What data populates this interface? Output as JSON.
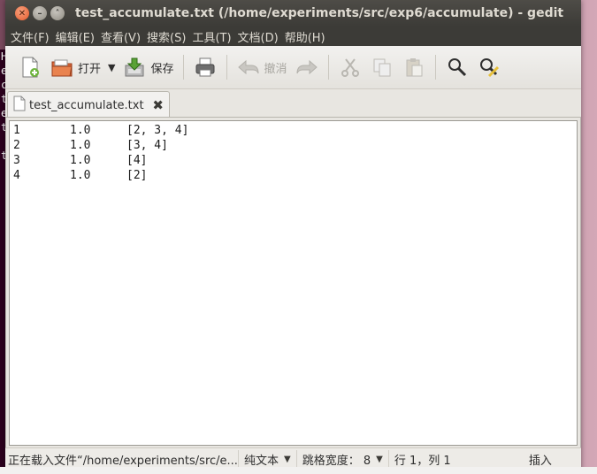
{
  "window": {
    "title": "test_accumulate.txt (/home/experiments/src/exp6/accumulate) - gedit"
  },
  "menu": [
    "文件(F)",
    "编辑(E)",
    "查看(V)",
    "搜索(S)",
    "工具(T)",
    "文档(D)",
    "帮助(H)"
  ],
  "toolbar": {
    "open_label": "打开",
    "save_label": "保存",
    "undo_label": "撤消"
  },
  "tab": {
    "label": "test_accumulate.txt"
  },
  "document": {
    "lines": [
      {
        "n": "1",
        "value": "1.0",
        "list": "[2, 3, 4]"
      },
      {
        "n": "2",
        "value": "1.0",
        "list": "[3, 4]"
      },
      {
        "n": "3",
        "value": "1.0",
        "list": "[4]"
      },
      {
        "n": "4",
        "value": "1.0",
        "list": "[2]"
      }
    ]
  },
  "status": {
    "message": "正在载入文件“/home/experiments/src/e...",
    "language": "纯文本",
    "tab_width": "跳格宽度： 8",
    "position": "行 1，列 1",
    "mode": "插入"
  },
  "colors": {
    "titlebar": "#3c3b37",
    "close_button": "#e45a2c",
    "editor_bg": "#ffffff"
  }
}
